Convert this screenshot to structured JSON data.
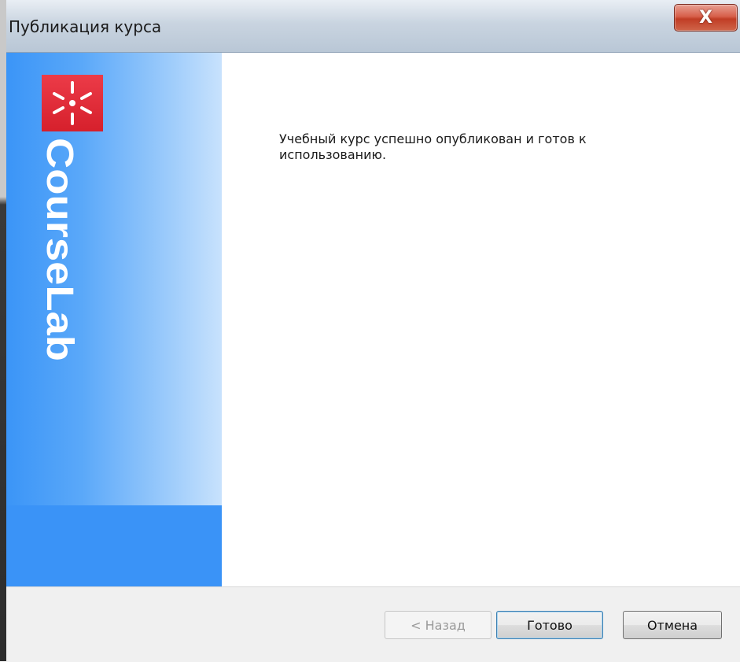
{
  "window": {
    "title": "Публикация курса",
    "close_icon": "close-icon",
    "close_glyph": "X"
  },
  "banner": {
    "logo_icon": "asterisk-logo-icon",
    "brand_text": "CourseLab",
    "colors": {
      "gradient_start": "#3b95f7",
      "gradient_end": "#c8e2fd",
      "logo_red": "#e02a36"
    }
  },
  "main": {
    "message": "Учебный курс успешно опубликован и готов к использованию."
  },
  "buttons": {
    "back_label": "< Назад",
    "finish_label": "Готово",
    "cancel_label": "Отмена"
  }
}
